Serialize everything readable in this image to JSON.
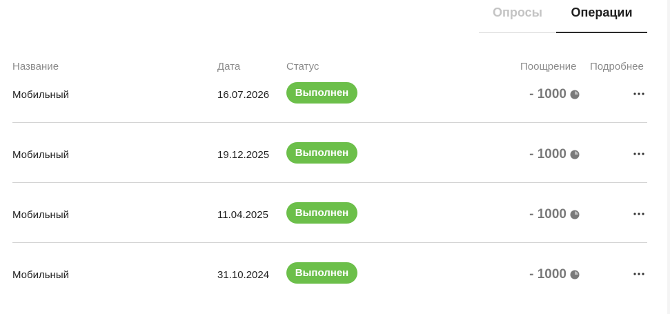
{
  "tabs": [
    {
      "label": "Опросы",
      "active": false
    },
    {
      "label": "Операции",
      "active": true
    }
  ],
  "table": {
    "headers": {
      "name": "Название",
      "date": "Дата",
      "status": "Статус",
      "reward": "Поощрение",
      "details": "Подробнее"
    },
    "rows": [
      {
        "name": "Мобильный",
        "date": "16.07.2026",
        "status": "Выполнен",
        "reward": "- 1000"
      },
      {
        "name": "Мобильный",
        "date": "19.12.2025",
        "status": "Выполнен",
        "reward": "- 1000"
      },
      {
        "name": "Мобильный",
        "date": "11.04.2025",
        "status": "Выполнен",
        "reward": "- 1000"
      },
      {
        "name": "Мобильный",
        "date": "31.10.2024",
        "status": "Выполнен",
        "reward": "- 1000"
      }
    ]
  },
  "icons": {
    "reward": "coin-icon",
    "details": "more-horizontal-icon"
  },
  "colors": {
    "status_done": "#6cbf4a",
    "tab_inactive": "#c4c4c4",
    "tab_active": "#1f1f1f",
    "reward_text": "#7a7a7a"
  }
}
